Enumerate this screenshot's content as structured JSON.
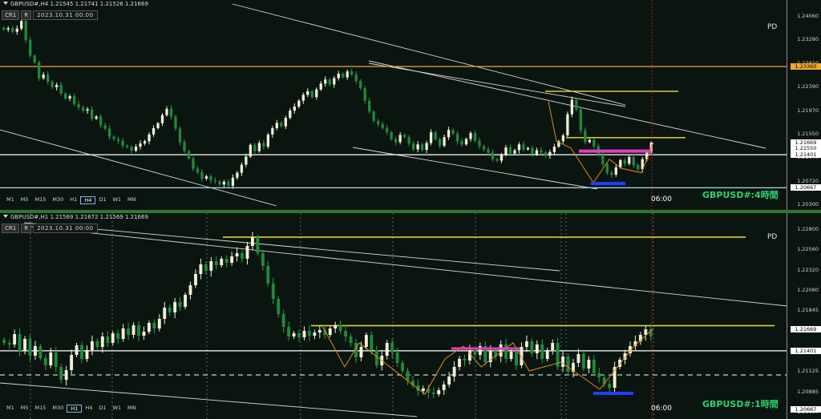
{
  "chart_data": [
    {
      "type": "candlestick",
      "header": "GBPUSD#,H4  1.21545 1.21741 1.21526 1.21669",
      "date_box": "2023.10.31 00:00",
      "pd_label": "PD",
      "symbol_label": "GBPUSD#:4時間",
      "time_label": "06:00",
      "y_ticks": [
        "1.24060",
        "1.23280",
        "1.22810",
        "1.22390",
        "1.21970",
        "1.21550",
        "1.21140",
        "1.20720",
        "1.20300"
      ],
      "price_labels": [
        {
          "text": "1.23360",
          "color": "#f0a830",
          "price": 1.2336
        },
        {
          "text": "1.21669",
          "color": "#ffffff",
          "price": 1.21669
        },
        {
          "text": "1.21550",
          "color": "#ffffff",
          "price": 1.2155
        },
        {
          "text": "1.21401",
          "color": "#ffffff",
          "price": 1.21401
        },
        {
          "text": "1.20667",
          "color": "#ffffff",
          "price": 1.20667
        }
      ],
      "ylim": [
        1.203,
        1.2448
      ],
      "timeframes": [
        "M1",
        "M5",
        "M15",
        "M30",
        "H1",
        "H4",
        "D1",
        "W1",
        "MN"
      ],
      "active_timeframe": "H4",
      "series_close": [
        1.2418,
        1.2421,
        1.2413,
        1.242,
        1.2437,
        1.2395,
        1.236,
        1.2345,
        1.231,
        1.2318,
        1.2302,
        1.229,
        1.2295,
        1.2276,
        1.2265,
        1.227,
        1.2252,
        1.2245,
        1.2238,
        1.2241,
        1.222,
        1.2225,
        1.2205,
        1.2198,
        1.218,
        1.2175,
        1.2171,
        1.216,
        1.2157,
        1.2149,
        1.2158,
        1.2165,
        1.217,
        1.2185,
        1.2199,
        1.221,
        1.2228,
        1.2242,
        1.2225,
        1.2198,
        1.2168,
        1.2148,
        1.2132,
        1.2109,
        1.2101,
        1.2087,
        1.2092,
        1.2083,
        1.2081,
        1.2074,
        1.208,
        1.2071,
        1.2089,
        1.21,
        1.2118,
        1.2136,
        1.2162,
        1.2148,
        1.2166,
        1.2158,
        1.2185,
        1.2199,
        1.2211,
        1.2203,
        1.2222,
        1.2238,
        1.2247,
        1.226,
        1.2273,
        1.2281,
        1.2268,
        1.2285,
        1.2298,
        1.2307,
        1.2296,
        1.231,
        1.232,
        1.2312,
        1.2325,
        1.2318,
        1.2304,
        1.2288,
        1.226,
        1.2236,
        1.2215,
        1.2208,
        1.2199,
        1.219,
        1.2175,
        1.2168,
        1.2184,
        1.2179,
        1.2165,
        1.2152,
        1.2163,
        1.2151,
        1.2166,
        1.219,
        1.2174,
        1.216,
        1.2179,
        1.2195,
        1.2187,
        1.217,
        1.2163,
        1.2175,
        1.2188,
        1.2171,
        1.2159,
        1.2152,
        1.2145,
        1.213,
        1.2127,
        1.214,
        1.2156,
        1.2143,
        1.215,
        1.2163,
        1.2152,
        1.2155,
        1.2141,
        1.215,
        1.2145,
        1.2138,
        1.2146,
        1.2158,
        1.217,
        1.2183,
        1.223,
        1.2262,
        1.2241,
        1.2194,
        1.2168,
        1.2173,
        1.2159,
        1.214,
        1.2119,
        1.21,
        1.2096,
        1.2112,
        1.2128,
        1.212,
        1.2135,
        1.2117,
        1.2108,
        1.213,
        1.2145,
        1.2167
      ]
    },
    {
      "type": "candlestick",
      "header": "GBPUSD#,H1  1.21569 1.21672 1.21569 1.21669",
      "date_box": "2023.10.31 00:00",
      "pd_label": "PD",
      "symbol_label": "GBPUSD#:1時間",
      "time_label": "06:00",
      "y_ticks": [
        "1.22800",
        "1.22560",
        "1.22320",
        "1.22080",
        "1.21845",
        "1.21605",
        "1.21365",
        "1.21125",
        "1.20885",
        "1.20667"
      ],
      "price_labels": [
        {
          "text": "1.21669",
          "color": "#ffffff",
          "price": 1.21669
        },
        {
          "text": "1.21401",
          "color": "#ffffff",
          "price": 1.21401
        },
        {
          "text": "1.20667",
          "color": "#ffffff",
          "price": 1.20667
        }
      ],
      "ylim": [
        1.2064,
        1.2292
      ],
      "timeframes": [
        "M1",
        "M5",
        "M15",
        "M30",
        "H1",
        "H4",
        "D1",
        "W1",
        "MN"
      ],
      "active_timeframe": "H1",
      "series_close": [
        1.215,
        1.2148,
        1.2161,
        1.214,
        1.2155,
        1.2134,
        1.2146,
        1.2131,
        1.2122,
        1.2138,
        1.212,
        1.2104,
        1.2116,
        1.2135,
        1.2147,
        1.213,
        1.2141,
        1.2152,
        1.2145,
        1.2158,
        1.215,
        1.2162,
        1.2155,
        1.2168,
        1.216,
        1.2172,
        1.2159,
        1.2164,
        1.2175,
        1.2168,
        1.218,
        1.2194,
        1.2188,
        1.2201,
        1.2195,
        1.221,
        1.2222,
        1.2236,
        1.2248,
        1.224,
        1.2252,
        1.2247,
        1.2255,
        1.225,
        1.2258,
        1.2262,
        1.2255,
        1.2271,
        1.2282,
        1.2262,
        1.2246,
        1.2224,
        1.2205,
        1.2186,
        1.217,
        1.2158,
        1.2162,
        1.2157,
        1.2165,
        1.2159,
        1.2163,
        1.2166,
        1.216,
        1.2168,
        1.2172,
        1.2165,
        1.2158,
        1.215,
        1.2132,
        1.2145,
        1.216,
        1.2141,
        1.2122,
        1.2134,
        1.215,
        1.2138,
        1.2125,
        1.2115,
        1.2103,
        1.2097,
        1.209,
        1.2093,
        1.2088,
        1.2086,
        1.2091,
        1.2098,
        1.2108,
        1.212,
        1.213,
        1.2128,
        1.2141,
        1.2135,
        1.2146,
        1.2126,
        1.214,
        1.2133,
        1.2148,
        1.213,
        1.2139,
        1.2122,
        1.2145,
        1.2152,
        1.2137,
        1.2148,
        1.213,
        1.2141,
        1.215,
        1.212,
        1.2133,
        1.2114,
        1.2125,
        1.2136,
        1.2118,
        1.2129,
        1.2112,
        1.2107,
        1.2099,
        1.2094,
        1.212,
        1.2129,
        1.2137,
        1.2146,
        1.2152,
        1.216,
        1.2167,
        1.2158
      ]
    }
  ]
}
